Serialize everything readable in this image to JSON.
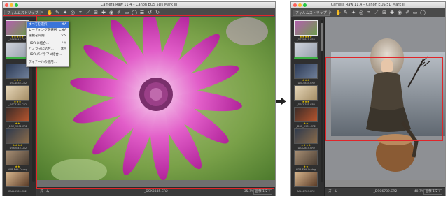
{
  "left_window": {
    "title": "Camera Raw 11.4  –  Canon EOS 5Ds Mark III",
    "filmstrip_label": "フィルムストリップ",
    "thumbs": [
      {
        "caption": "_DSX8845.CR2",
        "stars": "★★★★★"
      },
      {
        "caption": "",
        "stars": ""
      },
      {
        "caption": "_DSC4845.CR2",
        "stars": "★★★"
      },
      {
        "caption": "_DSC8765.CR2",
        "stars": "★★★"
      },
      {
        "caption": "_DSC_9901.CR2",
        "stars": "★★"
      },
      {
        "caption": "_DSX2845.CR2",
        "stars": "★★★★"
      },
      {
        "caption": "HDR-Edit-Cr.dng",
        "stars": "★★"
      },
      {
        "caption": "BALL8789.CR2",
        "stars": ""
      }
    ],
    "status_left": "ズーム",
    "status_file": "_DSX8845.CR2",
    "status_zoom": "35.7%",
    "status_mode": "画像 1/2 ▾",
    "menu": [
      {
        "label": "すべてを選択",
        "shortcut": "⌘A",
        "active": true
      },
      {
        "label": "レーティングを選択",
        "shortcut": "⌥⌘A",
        "active": false
      },
      {
        "label": "選択を同期...",
        "shortcut": "⌥S",
        "active": false
      },
      {
        "sep": true
      },
      {
        "label": "HDR に結合...",
        "shortcut": "⌃M",
        "active": false
      },
      {
        "label": "パノラマに結合...",
        "shortcut": "⌘M",
        "active": false
      },
      {
        "label": "HDR パノラマに結合...",
        "shortcut": "",
        "active": false
      },
      {
        "sep": true
      },
      {
        "label": "ディテールの適用...",
        "shortcut": "",
        "active": false
      }
    ]
  },
  "right_window": {
    "title": "Camera Raw 11.4  –  Canon EOS 5D Mark III",
    "filmstrip_label": "フィルムストリップ",
    "thumbs": [
      {
        "caption": "_DSX8845.CR2",
        "stars": "★★★★★"
      },
      {
        "caption": "",
        "stars": ""
      },
      {
        "caption": "_DSC4845.CR2",
        "stars": "★★★"
      },
      {
        "caption": "_DSC8765.CR2",
        "stars": "★★★"
      },
      {
        "caption": "_DSC_9901.CR2",
        "stars": "★★"
      },
      {
        "caption": "_DSX2845.CR2",
        "stars": "★★★★"
      },
      {
        "caption": "HDR-Edit-Cr.dng",
        "stars": "★★"
      },
      {
        "caption": "BALL8789.CR2",
        "stars": ""
      }
    ],
    "status_left": "ズーム",
    "status_file": "_DSC6789.CR2",
    "status_zoom": "40.7%",
    "status_mode": "画像 1/2 ▾"
  },
  "toolbar_icons": [
    "zoom-icon",
    "hand-icon",
    "white-balance-icon",
    "color-sampler-icon",
    "target-icon",
    "crop-icon",
    "straighten-icon",
    "transform-icon",
    "spot-removal-icon",
    "red-eye-icon",
    "brush-icon",
    "gradient-icon",
    "radial-icon",
    "prefs-icon",
    "rotate-left-icon",
    "rotate-right-icon"
  ],
  "colors": {
    "highlight": "#e0262a",
    "menu_active": "#3a74d9",
    "stars": "#e6c200"
  }
}
